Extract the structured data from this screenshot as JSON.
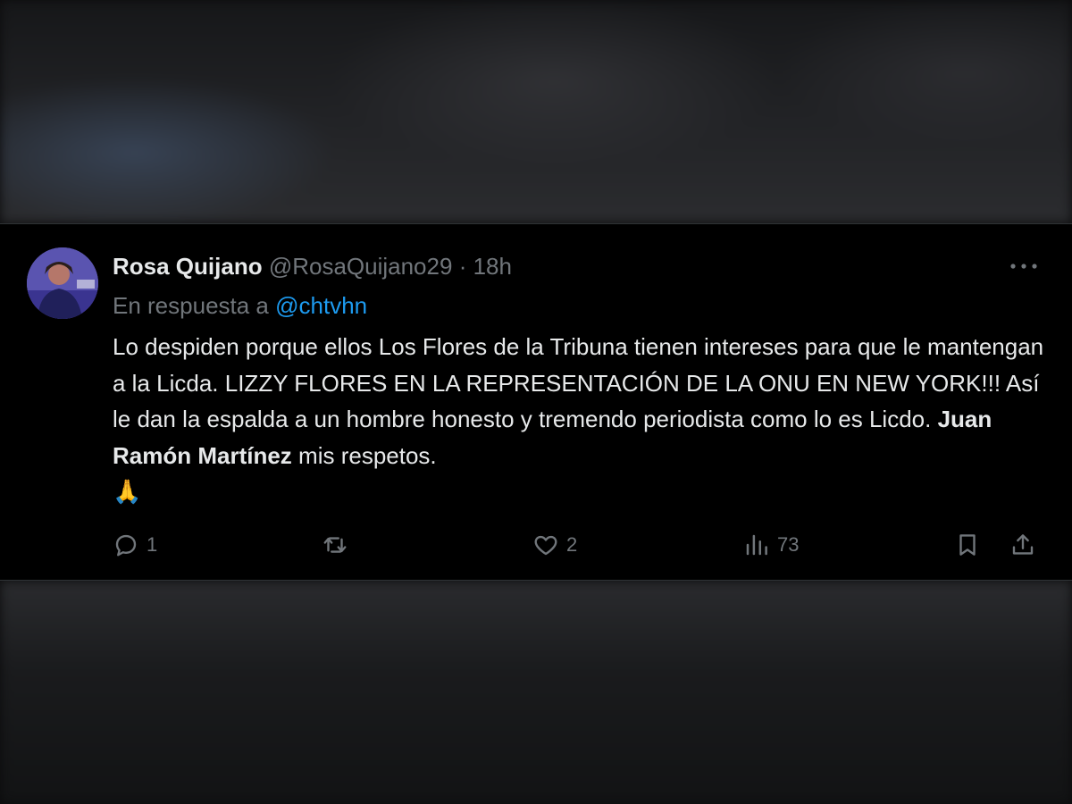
{
  "tweet": {
    "author_name": "Rosa Quijano",
    "author_handle": "@RosaQuijano29",
    "separator": "·",
    "timestamp": "18h",
    "reply_prefix": "En respuesta a",
    "reply_mention": "@chtvhn",
    "text_before_bold": "Lo despiden porque ellos Los Flores de la Tribuna tienen intereses para que le mantengan a la Licda. LIZZY FLORES EN LA REPRESENTACIÓN DE LA ONU EN NEW YORK!!! Así le dan la espalda a un hombre honesto y tremendo periodista como lo es Licdo.",
    "text_bold": "Juan Ramón Martínez",
    "text_after_bold": "mis respetos.",
    "emoji": "🙏"
  },
  "actions": {
    "reply_count": "1",
    "retweet_count": "",
    "like_count": "2",
    "views_count": "73"
  },
  "icons": {
    "more": "more-horizontal-icon",
    "reply": "reply-bubble-icon",
    "retweet": "retweet-icon",
    "like": "heart-icon",
    "views": "views-bar-chart-icon",
    "bookmark": "bookmark-icon",
    "share": "share-icon"
  },
  "colors": {
    "background": "#000000",
    "text_primary": "#e7e9ea",
    "text_secondary": "#71767b",
    "link": "#1d9bf0"
  }
}
